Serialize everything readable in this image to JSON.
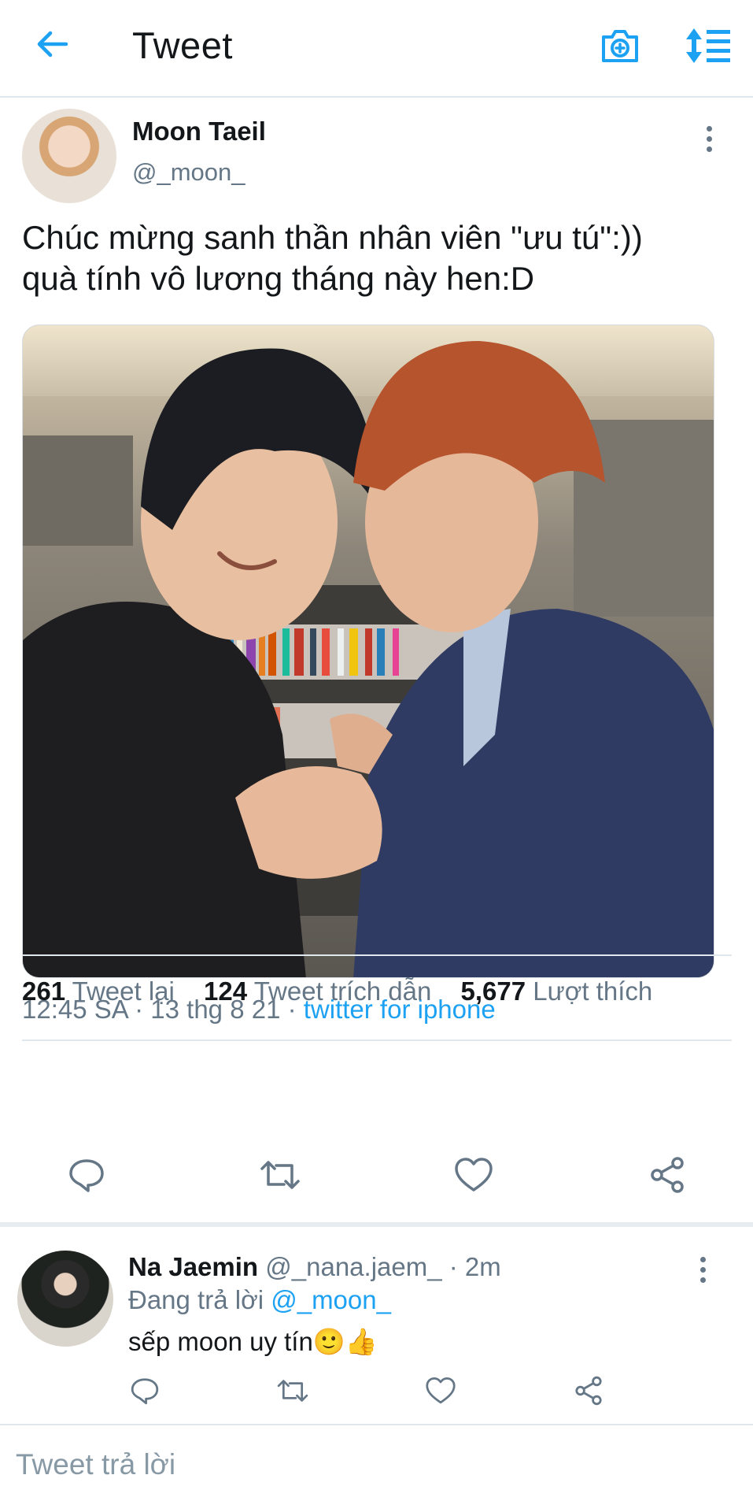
{
  "header": {
    "title": "Tweet",
    "icons": {
      "back": "arrow-left-icon",
      "camera": "camera-plus-icon",
      "sort": "sort-icon"
    },
    "accent": "#1da1f2"
  },
  "tweet": {
    "author_name": "Moon Taeil",
    "author_handle": "@_moon_",
    "text_line1": "Chúc mừng sanh thần nhân viên \"ưu tú\":))",
    "text_line2": "quà tính vô lương tháng này hen:D",
    "time_date": "12:45 SA · 13 thg 8 21 · ",
    "source": "twitter for iphone",
    "stats": {
      "retweets_count": "261",
      "retweets_label": "Tweet lại",
      "quotes_count": "124",
      "quotes_label": "Tweet trích dẫn",
      "likes_count": "5,677",
      "likes_label": "Lượt thích"
    },
    "actions": [
      "reply-icon",
      "retweet-icon",
      "like-icon",
      "share-icon"
    ]
  },
  "reply": {
    "name": "Na Jaemin",
    "handle_time": " @_nana.jaem_ · 2m",
    "replying_label": "Đang trả lời ",
    "replying_to": "@_moon_",
    "text": "sếp moon uy tín🙂👍"
  },
  "composer": {
    "placeholder": "Tweet trả lời"
  },
  "colors": {
    "text": "#14171a",
    "secondary": "#657786",
    "link": "#1da1f2",
    "divider": "#e1e8ed"
  }
}
